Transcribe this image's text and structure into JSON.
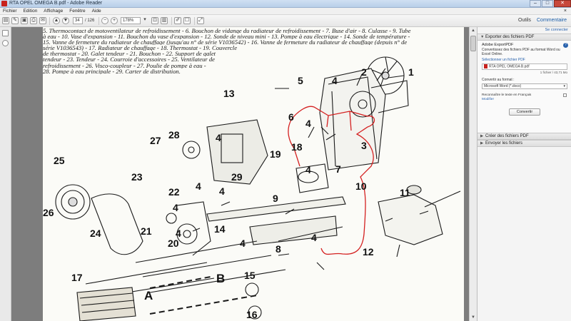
{
  "window": {
    "title": "RTA OPEL OMEGA B.pdf - Adobe Reader"
  },
  "menu": [
    "Fichier",
    "Edition",
    "Affichage",
    "Fenêtre",
    "Aide"
  ],
  "toolbar": {
    "page_current": "34",
    "page_total": "/ 126",
    "zoom": "178%",
    "tools_tab": "Outils",
    "comment_tab": "Commentaire"
  },
  "document": {
    "lines": [
      "5. Thermocontact de motoventilateur de refroidissement - 6. Bouchon de vidange du radiateur de refroidissement - 7. Buse d'air - 8. Culasse - 9. Tube",
      "à eau - 10. Vase d'expansion - 11. Bouchon du vase d'expansion - 12. Sonde de niveau mini - 13. Pompe à eau électrique - 14. Sonde de température -",
      "15. Vanne de fermeture du radiateur de chauffage (jusqu'au n° de série V1036542) - 16. Vanne de fermeture du radiateur de chauffage (depuis n° de",
      "série V1036543) - 17. Radiateur de chauffage - 18. Thermostat - 19. Couvercle",
      "de thermostat - 20. Galet tendeur - 21. Bouchon - 22. Support de galet",
      "tendeur - 23. Tendeur - 24. Courroie d'accessoires - 25. Ventilateur de",
      "refroidissement - 26. Visco-coupleur - 27. Poulie de pompe à eau -",
      "28. Pompe à eau principale - 29. Carter de distribution."
    ],
    "callouts": [
      "1",
      "2",
      "3",
      "4",
      "4",
      "4",
      "4",
      "4",
      "4",
      "4",
      "4",
      "4",
      "4",
      "5",
      "6",
      "7",
      "8",
      "9",
      "10",
      "11",
      "12",
      "13",
      "14",
      "15",
      "16",
      "17",
      "18",
      "19",
      "20",
      "21",
      "22",
      "23",
      "24",
      "25",
      "26",
      "27",
      "28",
      "29",
      "A",
      "B"
    ]
  },
  "panel": {
    "sign_in": "Se connecter",
    "export_title": "Exporter des fichiers PDF",
    "export_heading": "Adobe ExportPDF",
    "export_desc": "Convertissez des fichiers PDF au format Word ou Excel Online.",
    "select_label": "Sélectionner un fichier PDF",
    "file_name": "RTA OPEL OMEGA B.pdf",
    "file_meta": "1 fichier / 43,71 Mo",
    "convert_label": "Convertir au format :",
    "format_value": "Microsoft Word (*.docx)",
    "ocr_text": "Reconnaître le texte en Français",
    "ocr_link": "Modifier",
    "convert_button": "Convertir",
    "create_title": "Créer des fichiers PDF",
    "send_title": "Envoyer les fichiers"
  },
  "colors": {
    "annotation_red": "#d42020",
    "titlebar": "#c6d8ee",
    "adobe_red": "#c8221d"
  }
}
